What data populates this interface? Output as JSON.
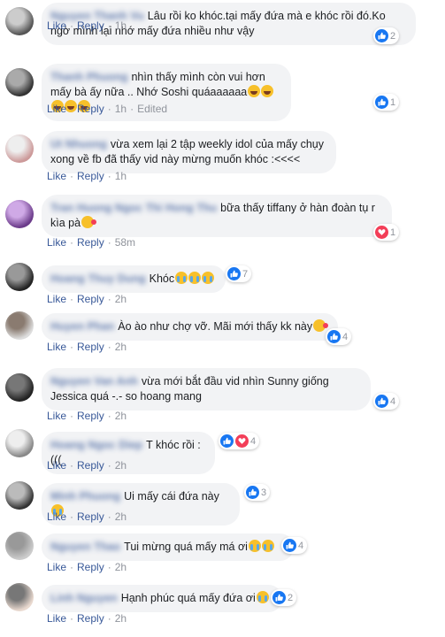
{
  "actions": {
    "like": "Like",
    "reply": "Reply",
    "edited": "Edited",
    "sep": "·"
  },
  "colors": {
    "link": "#385898",
    "bubble": "#f2f3f5",
    "like": "#1877f2",
    "love": "#f33e58"
  },
  "comments": [
    {
      "author": "Nguyen Thanh Vu",
      "text": "Lâu rồi ko khóc.tại mấy đứa mà e khóc rồi đó.Ko ngờ mình lại nhớ mấy đứa nhiều như vậy",
      "time": "1h",
      "reactions": [
        "like"
      ],
      "count": "2"
    },
    {
      "author": "Thanh Phuong",
      "text": "nhìn thấy mình còn vui hơn mấy bà ấy nữa .. Nhớ Soshi quáaaaaaa",
      "emoji": [
        "laugh",
        "laugh",
        "laugh",
        "laugh",
        "laugh"
      ],
      "time": "1h",
      "edited": true,
      "reactions": [
        "like"
      ],
      "count": "1"
    },
    {
      "author": "Ut Nhuong",
      "text": "vừa xem lại 2 tập weekly idol của mấy chụy xong về fb đã thấy vid này mừng muốn khóc :<<<<",
      "time": "1h",
      "reactions": [],
      "count": ""
    },
    {
      "author": "Tran Huong Ngoc Thi Hong Thu",
      "text": "bữa thấy tiffany ở hàn đoàn tụ r kìa pà",
      "emoji": [
        "kiss"
      ],
      "time": "58m",
      "reactions": [
        "love"
      ],
      "count": "1"
    },
    {
      "author": "Hoang Thuy Dung",
      "text": "Khóc",
      "emoji": [
        "cry",
        "cry",
        "cry"
      ],
      "time": "2h",
      "reactions": [
        "like"
      ],
      "count": "7"
    },
    {
      "author": "Huyen Phan",
      "text": "Ào ào như chợ vỡ. Mãi mới thấy kk này",
      "emoji": [
        "kiss"
      ],
      "time": "2h",
      "reactions": [
        "like"
      ],
      "count": "4"
    },
    {
      "author": "Nguyen Van Anh",
      "text": "vừa mới bắt đầu vid nhìn Sunny giống Jessica quá -.- so hoang mang",
      "time": "2h",
      "reactions": [
        "like"
      ],
      "count": "4"
    },
    {
      "author": "Hoang Ngoc Diep",
      "text": "T khóc rồi :(((",
      "time": "2h",
      "reactions": [
        "like",
        "love"
      ],
      "count": "4"
    },
    {
      "author": "Minh Phuong",
      "text": "Ui mấy cái đứa này",
      "emoji": [
        "cry"
      ],
      "time": "2h",
      "reactions": [
        "like"
      ],
      "count": "3"
    },
    {
      "author": "Nguyen Thao",
      "text": "Tui mừng quá mấy má ơi",
      "emoji": [
        "cry",
        "cry"
      ],
      "time": "2h",
      "reactions": [
        "like"
      ],
      "count": "4"
    },
    {
      "author": "Linh Nguyen",
      "text": "Hạnh phúc quá mấy đứa ơi",
      "emoji": [
        "cry"
      ],
      "time": "2h",
      "reactions": [
        "like"
      ],
      "count": "2"
    }
  ]
}
